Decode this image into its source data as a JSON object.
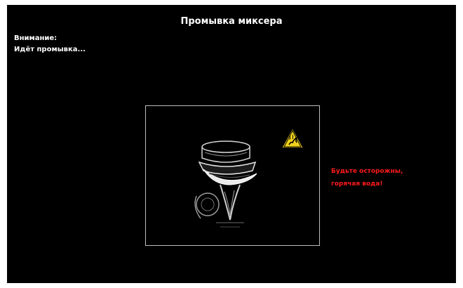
{
  "window": {
    "title": "Промывка миксера"
  },
  "notice": {
    "line1": "Внимание:",
    "line2": "Идёт промывка..."
  },
  "illustration": {
    "icon": "warning-icon",
    "image": "mixer-image"
  },
  "caution": {
    "line1": "Будьте осторожны,",
    "line2": "горячая вода!"
  },
  "colors": {
    "background": "#000000",
    "text": "#ffffff",
    "caution": "#ff1a1a",
    "warning_fill": "#f2d21b",
    "frame": "#bdbdbd"
  }
}
